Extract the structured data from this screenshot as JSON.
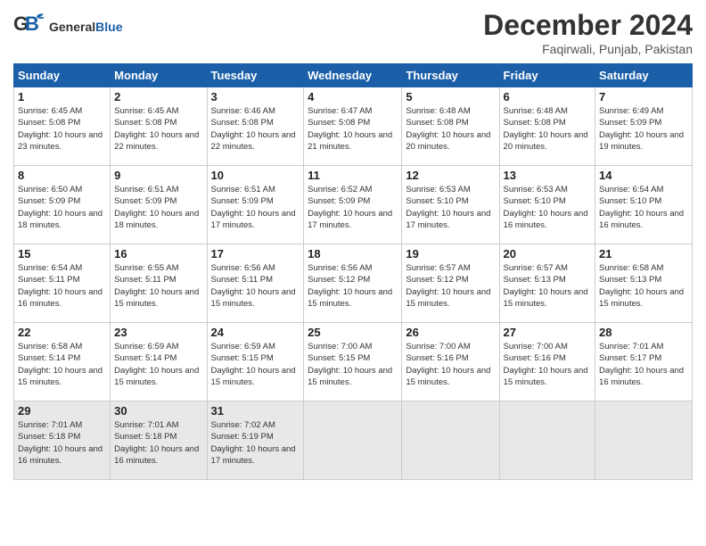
{
  "header": {
    "logo_general": "General",
    "logo_blue": "Blue",
    "month_year": "December 2024",
    "location": "Faqirwali, Punjab, Pakistan"
  },
  "weekdays": [
    "Sunday",
    "Monday",
    "Tuesday",
    "Wednesday",
    "Thursday",
    "Friday",
    "Saturday"
  ],
  "weeks": [
    [
      {
        "day": "1",
        "sunrise": "Sunrise: 6:45 AM",
        "sunset": "Sunset: 5:08 PM",
        "daylight": "Daylight: 10 hours and 23 minutes."
      },
      {
        "day": "2",
        "sunrise": "Sunrise: 6:45 AM",
        "sunset": "Sunset: 5:08 PM",
        "daylight": "Daylight: 10 hours and 22 minutes."
      },
      {
        "day": "3",
        "sunrise": "Sunrise: 6:46 AM",
        "sunset": "Sunset: 5:08 PM",
        "daylight": "Daylight: 10 hours and 22 minutes."
      },
      {
        "day": "4",
        "sunrise": "Sunrise: 6:47 AM",
        "sunset": "Sunset: 5:08 PM",
        "daylight": "Daylight: 10 hours and 21 minutes."
      },
      {
        "day": "5",
        "sunrise": "Sunrise: 6:48 AM",
        "sunset": "Sunset: 5:08 PM",
        "daylight": "Daylight: 10 hours and 20 minutes."
      },
      {
        "day": "6",
        "sunrise": "Sunrise: 6:48 AM",
        "sunset": "Sunset: 5:08 PM",
        "daylight": "Daylight: 10 hours and 20 minutes."
      },
      {
        "day": "7",
        "sunrise": "Sunrise: 6:49 AM",
        "sunset": "Sunset: 5:09 PM",
        "daylight": "Daylight: 10 hours and 19 minutes."
      }
    ],
    [
      {
        "day": "8",
        "sunrise": "Sunrise: 6:50 AM",
        "sunset": "Sunset: 5:09 PM",
        "daylight": "Daylight: 10 hours and 18 minutes."
      },
      {
        "day": "9",
        "sunrise": "Sunrise: 6:51 AM",
        "sunset": "Sunset: 5:09 PM",
        "daylight": "Daylight: 10 hours and 18 minutes."
      },
      {
        "day": "10",
        "sunrise": "Sunrise: 6:51 AM",
        "sunset": "Sunset: 5:09 PM",
        "daylight": "Daylight: 10 hours and 17 minutes."
      },
      {
        "day": "11",
        "sunrise": "Sunrise: 6:52 AM",
        "sunset": "Sunset: 5:09 PM",
        "daylight": "Daylight: 10 hours and 17 minutes."
      },
      {
        "day": "12",
        "sunrise": "Sunrise: 6:53 AM",
        "sunset": "Sunset: 5:10 PM",
        "daylight": "Daylight: 10 hours and 17 minutes."
      },
      {
        "day": "13",
        "sunrise": "Sunrise: 6:53 AM",
        "sunset": "Sunset: 5:10 PM",
        "daylight": "Daylight: 10 hours and 16 minutes."
      },
      {
        "day": "14",
        "sunrise": "Sunrise: 6:54 AM",
        "sunset": "Sunset: 5:10 PM",
        "daylight": "Daylight: 10 hours and 16 minutes."
      }
    ],
    [
      {
        "day": "15",
        "sunrise": "Sunrise: 6:54 AM",
        "sunset": "Sunset: 5:11 PM",
        "daylight": "Daylight: 10 hours and 16 minutes."
      },
      {
        "day": "16",
        "sunrise": "Sunrise: 6:55 AM",
        "sunset": "Sunset: 5:11 PM",
        "daylight": "Daylight: 10 hours and 15 minutes."
      },
      {
        "day": "17",
        "sunrise": "Sunrise: 6:56 AM",
        "sunset": "Sunset: 5:11 PM",
        "daylight": "Daylight: 10 hours and 15 minutes."
      },
      {
        "day": "18",
        "sunrise": "Sunrise: 6:56 AM",
        "sunset": "Sunset: 5:12 PM",
        "daylight": "Daylight: 10 hours and 15 minutes."
      },
      {
        "day": "19",
        "sunrise": "Sunrise: 6:57 AM",
        "sunset": "Sunset: 5:12 PM",
        "daylight": "Daylight: 10 hours and 15 minutes."
      },
      {
        "day": "20",
        "sunrise": "Sunrise: 6:57 AM",
        "sunset": "Sunset: 5:13 PM",
        "daylight": "Daylight: 10 hours and 15 minutes."
      },
      {
        "day": "21",
        "sunrise": "Sunrise: 6:58 AM",
        "sunset": "Sunset: 5:13 PM",
        "daylight": "Daylight: 10 hours and 15 minutes."
      }
    ],
    [
      {
        "day": "22",
        "sunrise": "Sunrise: 6:58 AM",
        "sunset": "Sunset: 5:14 PM",
        "daylight": "Daylight: 10 hours and 15 minutes."
      },
      {
        "day": "23",
        "sunrise": "Sunrise: 6:59 AM",
        "sunset": "Sunset: 5:14 PM",
        "daylight": "Daylight: 10 hours and 15 minutes."
      },
      {
        "day": "24",
        "sunrise": "Sunrise: 6:59 AM",
        "sunset": "Sunset: 5:15 PM",
        "daylight": "Daylight: 10 hours and 15 minutes."
      },
      {
        "day": "25",
        "sunrise": "Sunrise: 7:00 AM",
        "sunset": "Sunset: 5:15 PM",
        "daylight": "Daylight: 10 hours and 15 minutes."
      },
      {
        "day": "26",
        "sunrise": "Sunrise: 7:00 AM",
        "sunset": "Sunset: 5:16 PM",
        "daylight": "Daylight: 10 hours and 15 minutes."
      },
      {
        "day": "27",
        "sunrise": "Sunrise: 7:00 AM",
        "sunset": "Sunset: 5:16 PM",
        "daylight": "Daylight: 10 hours and 15 minutes."
      },
      {
        "day": "28",
        "sunrise": "Sunrise: 7:01 AM",
        "sunset": "Sunset: 5:17 PM",
        "daylight": "Daylight: 10 hours and 16 minutes."
      }
    ],
    [
      {
        "day": "29",
        "sunrise": "Sunrise: 7:01 AM",
        "sunset": "Sunset: 5:18 PM",
        "daylight": "Daylight: 10 hours and 16 minutes."
      },
      {
        "day": "30",
        "sunrise": "Sunrise: 7:01 AM",
        "sunset": "Sunset: 5:18 PM",
        "daylight": "Daylight: 10 hours and 16 minutes."
      },
      {
        "day": "31",
        "sunrise": "Sunrise: 7:02 AM",
        "sunset": "Sunset: 5:19 PM",
        "daylight": "Daylight: 10 hours and 17 minutes."
      },
      {
        "day": "",
        "sunrise": "",
        "sunset": "",
        "daylight": ""
      },
      {
        "day": "",
        "sunrise": "",
        "sunset": "",
        "daylight": ""
      },
      {
        "day": "",
        "sunrise": "",
        "sunset": "",
        "daylight": ""
      },
      {
        "day": "",
        "sunrise": "",
        "sunset": "",
        "daylight": ""
      }
    ]
  ]
}
